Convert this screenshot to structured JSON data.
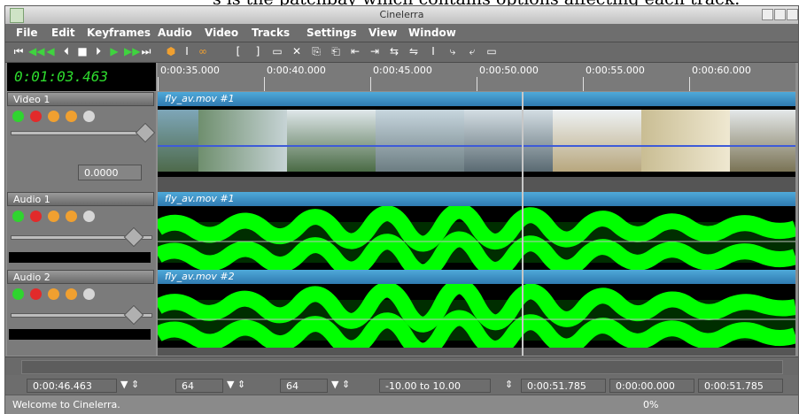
{
  "caption": "s is the patchbay which contains options affecting each track.",
  "window": {
    "title": "Cinelerra"
  },
  "menu": [
    "File",
    "Edit",
    "Keyframes",
    "Audio",
    "Video",
    "Tracks",
    "Settings",
    "View",
    "Window"
  ],
  "toolbar_icons": [
    "⏮",
    "◀◀",
    "◀",
    "⏴",
    "■",
    "⏵",
    "▶",
    "▶▶",
    "⏭",
    "⬢",
    "I",
    "∞",
    "[",
    "]",
    "▭",
    "✕",
    "⎘",
    "⎗",
    "⇤",
    "⇥",
    "⇆",
    "⇋",
    "I",
    "⤷",
    "⤶",
    "▭"
  ],
  "clock": "0:01:03.463",
  "ruler_labels": [
    "0:00:35.000",
    "0:00:40.000",
    "0:00:45.000",
    "0:00:50.000",
    "0:00:55.000",
    "0:00:60.000"
  ],
  "tracks": [
    {
      "name": "Video 1",
      "clip": "fly_av.mov #1",
      "type": "video"
    },
    {
      "name": "Audio 1",
      "clip": "fly_av.mov #1",
      "type": "audio"
    },
    {
      "name": "Audio 2",
      "clip": "fly_av.mov #2",
      "type": "audio"
    }
  ],
  "video_patch_value": "0.0000",
  "bottom_bar": {
    "selection_start": "0:00:46.463",
    "zoom_a": "64",
    "zoom_b": "64",
    "amp_range": "-10.00 to 10.00",
    "pos_1": "0:00:51.785",
    "pos_2": "0:00:00.000",
    "pos_3": "0:00:51.785"
  },
  "status": {
    "message": "Welcome to Cinelerra.",
    "progress": "0%"
  }
}
